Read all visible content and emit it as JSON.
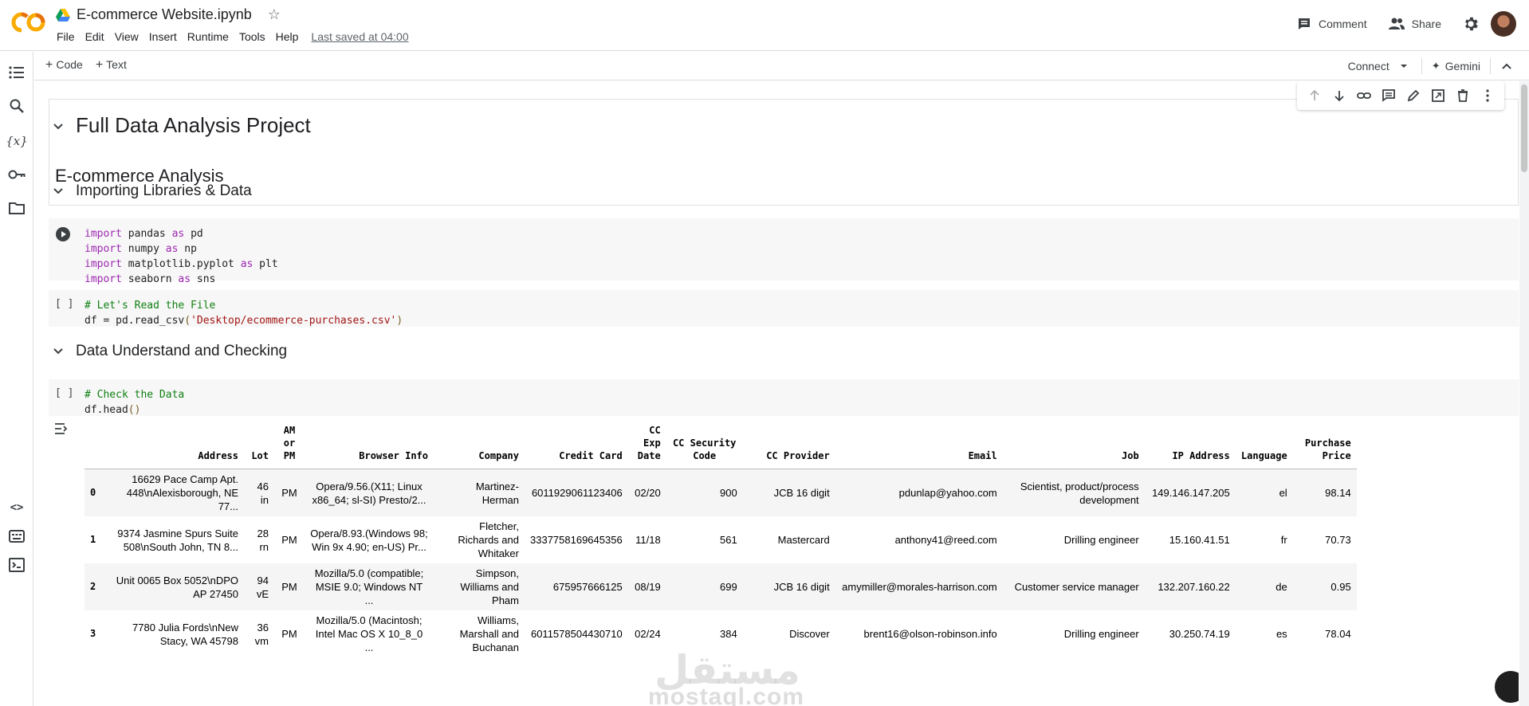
{
  "header": {
    "title": "E-commerce Website.ipynb",
    "menu": [
      "File",
      "Edit",
      "View",
      "Insert",
      "Runtime",
      "Tools",
      "Help"
    ],
    "last_saved": "Last saved at 04:00",
    "comment_label": "Comment",
    "share_label": "Share"
  },
  "toolbar": {
    "code_label": "Code",
    "text_label": "Text",
    "connect_label": "Connect",
    "gemini_label": "Gemini"
  },
  "cells": {
    "h1": "Full Data Analysis Project",
    "h2": "E-commerce Analysis",
    "section1": "Importing Libraries & Data",
    "section2": "Data Understand and Checking",
    "empty_bracket": "[ ]"
  },
  "code": {
    "import_kw": "import",
    "as_kw": "as",
    "imports": [
      {
        "module": "pandas",
        "alias": "pd"
      },
      {
        "module": "numpy",
        "alias": "np"
      },
      {
        "module": "matplotlib.pyplot",
        "alias": "plt"
      },
      {
        "module": "seaborn",
        "alias": "sns"
      }
    ],
    "read_comment": "# Let's Read the File",
    "read_prefix": "df = pd.read_csv",
    "read_path": "'Desktop/ecommerce-purchases.csv'",
    "check_comment": "# Check the Data",
    "head_call": "df.head"
  },
  "table": {
    "columns": [
      "",
      "Address",
      "Lot",
      "AM or PM",
      "Browser Info",
      "Company",
      "Credit Card",
      "CC Exp Date",
      "CC Security Code",
      "CC Provider",
      "Email",
      "Job",
      "IP Address",
      "Language",
      "Purchase Price"
    ],
    "rows": [
      [
        "0",
        "16629 Pace Camp Apt. 448\\nAlexisborough, NE 77...",
        "46 in",
        "PM",
        "Opera/9.56.(X11; Linux x86_64; sl-SI) Presto/2...",
        "Martinez-Herman",
        "6011929061123406",
        "02/20",
        "900",
        "JCB 16 digit",
        "pdunlap@yahoo.com",
        "Scientist, product/process development",
        "149.146.147.205",
        "el",
        "98.14"
      ],
      [
        "1",
        "9374 Jasmine Spurs Suite 508\\nSouth John, TN 8...",
        "28 rn",
        "PM",
        "Opera/8.93.(Windows 98; Win 9x 4.90; en-US) Pr...",
        "Fletcher, Richards and Whitaker",
        "3337758169645356",
        "11/18",
        "561",
        "Mastercard",
        "anthony41@reed.com",
        "Drilling engineer",
        "15.160.41.51",
        "fr",
        "70.73"
      ],
      [
        "2",
        "Unit 0065 Box 5052\\nDPO AP 27450",
        "94 vE",
        "PM",
        "Mozilla/5.0 (compatible; MSIE 9.0; Windows NT ...",
        "Simpson, Williams and Pham",
        "675957666125",
        "08/19",
        "699",
        "JCB 16 digit",
        "amymiller@morales-harrison.com",
        "Customer service manager",
        "132.207.160.22",
        "de",
        "0.95"
      ],
      [
        "3",
        "7780 Julia Fords\\nNew Stacy, WA 45798",
        "36 vm",
        "PM",
        "Mozilla/5.0 (Macintosh; Intel Mac OS X 10_8_0 ...",
        "Williams, Marshall and Buchanan",
        "6011578504430710",
        "02/24",
        "384",
        "Discover",
        "brent16@olson-robinson.info",
        "Drilling engineer",
        "30.250.74.19",
        "es",
        "78.04"
      ]
    ]
  },
  "watermark": {
    "latin": "mostaql.com",
    "arabic": "مستقل"
  }
}
